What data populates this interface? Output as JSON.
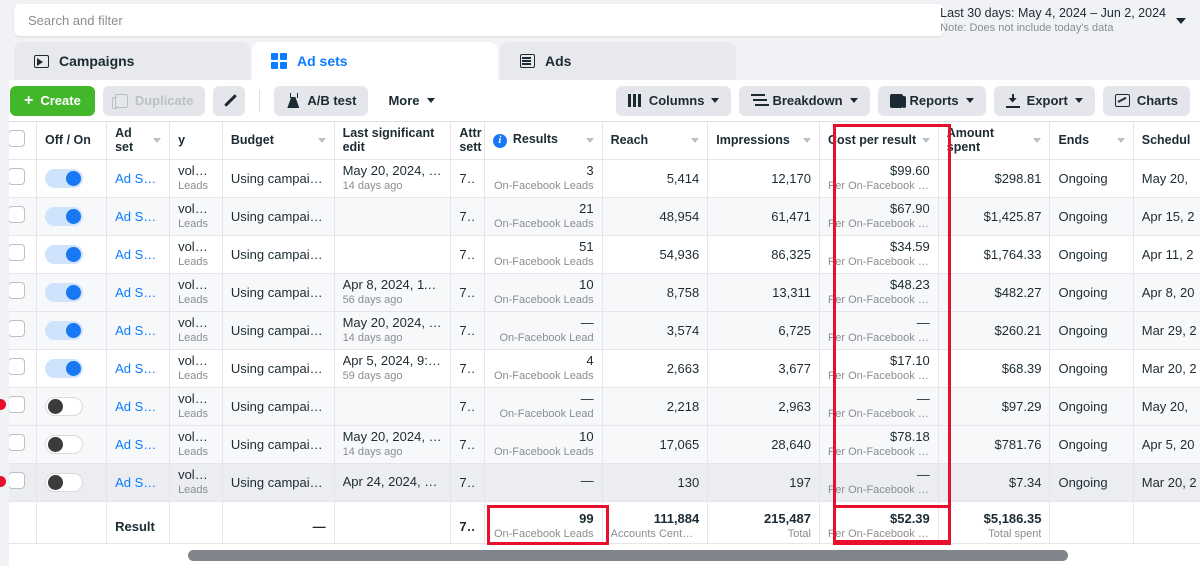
{
  "search": {
    "placeholder": "Search and filter"
  },
  "daterange": {
    "main": "Last 30 days: May 4, 2024 – Jun 2, 2024",
    "note": "Note: Does not include today's data"
  },
  "tabs": [
    {
      "label": "Campaigns",
      "icon": "folder-icon",
      "active": false
    },
    {
      "label": "Ad sets",
      "icon": "grid-icon",
      "active": true
    },
    {
      "label": "Ads",
      "icon": "ads-icon",
      "active": false
    }
  ],
  "toolbar": {
    "create": "Create",
    "duplicate": "Duplicate",
    "edit_icon": "pencil-icon",
    "ab_test": "A/B test",
    "more": "More",
    "columns": "Columns",
    "breakdown": "Breakdown",
    "reports": "Reports",
    "export": "Export",
    "charts": "Charts"
  },
  "table": {
    "columns": [
      {
        "key": "check",
        "label": ""
      },
      {
        "key": "onoff",
        "label": "Off / On"
      },
      {
        "key": "adset",
        "label": "Ad set"
      },
      {
        "key": "deliv",
        "label": "y"
      },
      {
        "key": "budget",
        "label": "Budget"
      },
      {
        "key": "edit",
        "label": "Last significant edit"
      },
      {
        "key": "attr",
        "label": "Attr sett"
      },
      {
        "key": "result",
        "label": "Results"
      },
      {
        "key": "reach",
        "label": "Reach"
      },
      {
        "key": "impr",
        "label": "Impressions"
      },
      {
        "key": "cpr",
        "label": "Cost per result"
      },
      {
        "key": "spent",
        "label": "Amount spent"
      },
      {
        "key": "ends",
        "label": "Ends"
      },
      {
        "key": "sched",
        "label": "Schedul"
      }
    ],
    "rows": [
      {
        "toggle": "on",
        "adset": "Ad Set...",
        "deliv_main": "volume",
        "deliv_sub": "Leads",
        "budget": "Using campaign ...",
        "edit_main": "May 20, 2024, 11:...",
        "edit_sub": "14 days ago",
        "attr": "7-...",
        "result": "3",
        "result_sub": "On-Facebook Leads",
        "reach": "5,414",
        "impr": "12,170",
        "cpr": "$99.60",
        "cpr_sub": "Per On-Facebook Le...",
        "spent": "$298.81",
        "ends": "Ongoing",
        "sched": "May 20,"
      },
      {
        "toggle": "on",
        "adset": "Ad Set...",
        "deliv_main": "volume",
        "deliv_sub": "Leads",
        "budget": "Using campaign ...",
        "edit_main": "",
        "edit_sub": "",
        "attr": "7-...",
        "result": "21",
        "result_sub": "On-Facebook Leads",
        "reach": "48,954",
        "impr": "61,471",
        "cpr": "$67.90",
        "cpr_sub": "Per On-Facebook Le...",
        "spent": "$1,425.87",
        "ends": "Ongoing",
        "sched": "Apr 15, 2"
      },
      {
        "toggle": "on",
        "adset": "Ad Set...",
        "deliv_main": "volume",
        "deliv_sub": "Leads",
        "budget": "Using campaign ...",
        "edit_main": "",
        "edit_sub": "",
        "attr": "7-...",
        "result": "51",
        "result_sub": "On-Facebook Leads",
        "reach": "54,936",
        "impr": "86,325",
        "cpr": "$34.59",
        "cpr_sub": "Per On-Facebook Le...",
        "spent": "$1,764.33",
        "ends": "Ongoing",
        "sched": "Apr 11, 2"
      },
      {
        "toggle": "on",
        "adset": "Ad Set...",
        "deliv_main": "volume",
        "deliv_sub": "Leads",
        "budget": "Using campaign ...",
        "edit_main": "Apr 8, 2024, 11:56...",
        "edit_sub": "56 days ago",
        "attr": "7-...",
        "result": "10",
        "result_sub": "On-Facebook Leads",
        "reach": "8,758",
        "impr": "13,311",
        "cpr": "$48.23",
        "cpr_sub": "Per On-Facebook Le...",
        "spent": "$482.27",
        "ends": "Ongoing",
        "sched": "Apr 8, 20"
      },
      {
        "toggle": "on",
        "adset": "Ad Set...",
        "deliv_main": "volume",
        "deliv_sub": "Leads",
        "budget": "Using campaign ...",
        "edit_main": "May 20, 2024, 11:...",
        "edit_sub": "14 days ago",
        "attr": "7-...",
        "result": "—",
        "result_sub": "On-Facebook Lead",
        "reach": "3,574",
        "impr": "6,725",
        "cpr": "—",
        "cpr_sub": "Per On-Facebook Le...",
        "spent": "$260.21",
        "ends": "Ongoing",
        "sched": "Mar 29, 2"
      },
      {
        "toggle": "on",
        "adset": "Ad Set...",
        "deliv_main": "volume",
        "deliv_sub": "Leads",
        "budget": "Using campaign ...",
        "edit_main": "Apr 5, 2024, 9:16 ...",
        "edit_sub": "59 days ago",
        "attr": "7-...",
        "result": "4",
        "result_sub": "On-Facebook Leads",
        "reach": "2,663",
        "impr": "3,677",
        "cpr": "$17.10",
        "cpr_sub": "Per On-Facebook Le...",
        "spent": "$68.39",
        "ends": "Ongoing",
        "sched": "Mar 20, 2"
      },
      {
        "toggle": "off",
        "adset": "Ad Set...",
        "deliv_main": "volume",
        "deliv_sub": "Leads",
        "budget": "Using campaign ...",
        "edit_main": "",
        "edit_sub": "",
        "attr": "7-...",
        "result": "—",
        "result_sub": "On-Facebook Lead",
        "reach": "2,218",
        "impr": "2,963",
        "cpr": "—",
        "cpr_sub": "Per On-Facebook Le...",
        "spent": "$97.29",
        "ends": "Ongoing",
        "sched": "May 20,"
      },
      {
        "toggle": "off",
        "adset": "Ad Set...",
        "deliv_main": "volume",
        "deliv_sub": "Leads",
        "budget": "Using campaign ...",
        "edit_main": "May 20, 2024, 11:...",
        "edit_sub": "14 days ago",
        "attr": "7-...",
        "result": "10",
        "result_sub": "On-Facebook Leads",
        "reach": "17,065",
        "impr": "28,640",
        "cpr": "$78.18",
        "cpr_sub": "Per On-Facebook Le...",
        "spent": "$781.76",
        "ends": "Ongoing",
        "sched": "Apr 5, 20"
      },
      {
        "toggle": "off",
        "adset": "Ad Set...",
        "deliv_main": "volume",
        "deliv_sub": "Leads",
        "budget": "Using campaign ...",
        "edit_main": "Apr 24, 2024, 9:22...",
        "edit_sub": "",
        "attr": "7-...",
        "result": "—",
        "result_sub": "",
        "reach": "130",
        "impr": "197",
        "cpr": "—",
        "cpr_sub": "Per On-Facebook Le...",
        "spent": "$7.34",
        "ends": "Ongoing",
        "sched": "Mar 20, 2"
      }
    ],
    "totals": {
      "label": "Result",
      "budget": "—",
      "attr": "7...",
      "result": "99",
      "result_sub": "On-Facebook Leads",
      "reach": "111,884",
      "reach_sub": "Accounts Center acc...",
      "impr": "215,487",
      "impr_sub": "Total",
      "cpr": "$52.39",
      "cpr_sub": "Per On-Facebook Le...",
      "spent": "$5,186.35",
      "spent_sub": "Total spent"
    }
  },
  "annotations": {
    "accent_color": "#e8112d",
    "boxes": [
      {
        "name": "cost-per-result-column-highlight"
      },
      {
        "name": "results-total-highlight"
      },
      {
        "name": "cost-per-result-total-highlight"
      }
    ]
  }
}
